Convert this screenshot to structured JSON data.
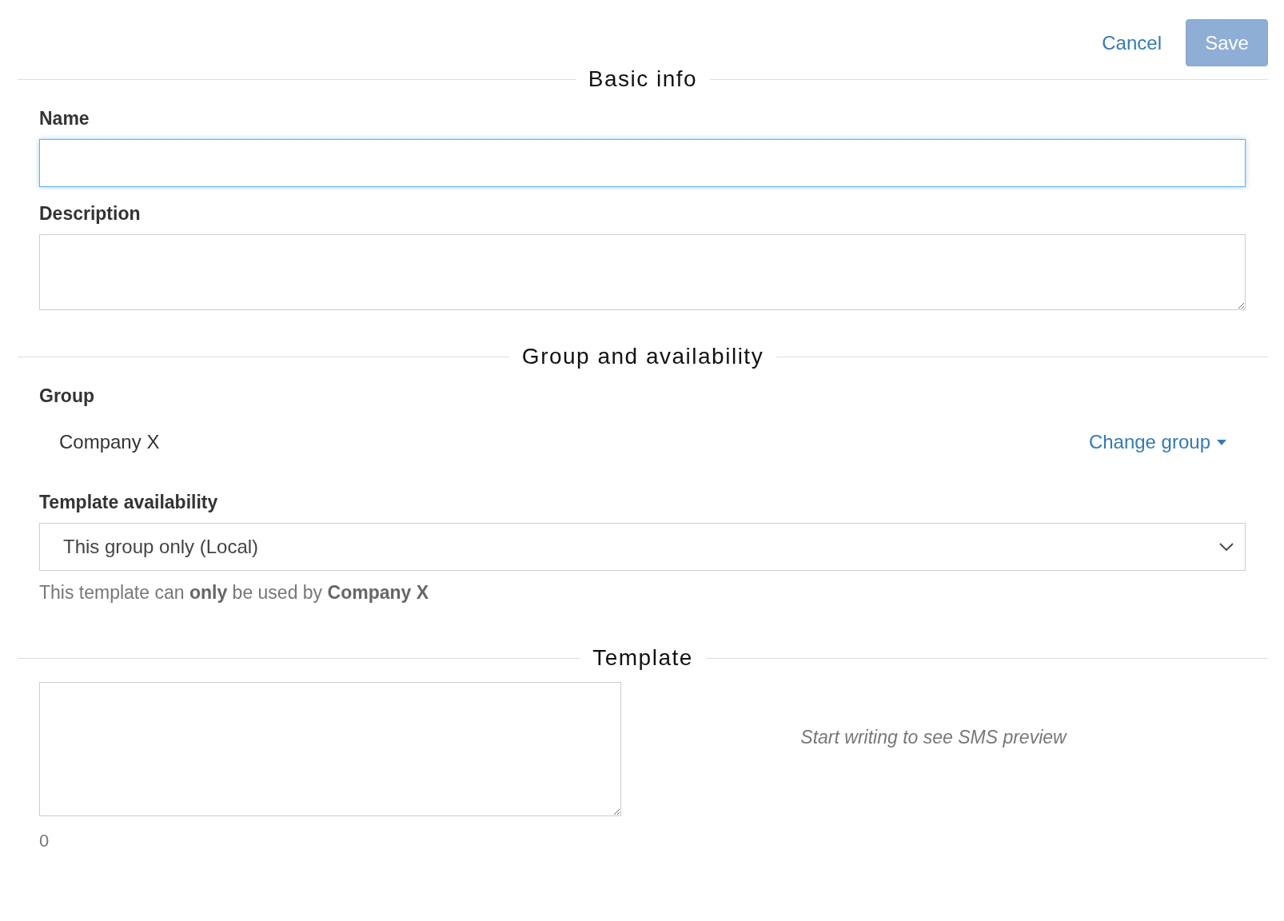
{
  "actions": {
    "cancel": "Cancel",
    "save": {
      "label": "Save",
      "disabled": true
    }
  },
  "sections": [
    {
      "heading": "Basic info",
      "fields": [
        {
          "kind": "text",
          "label": "Name",
          "focused": true
        },
        {
          "kind": "textarea",
          "label": "Description"
        }
      ]
    },
    {
      "heading": "Group and availability",
      "fields": [
        {
          "kind": "group",
          "label": "Group",
          "value": "Company X",
          "action": "Change group"
        },
        {
          "kind": "select",
          "label": "Template availability",
          "value": "This group only (Local)",
          "help": "This template can **only** be used by **Company X**"
        }
      ]
    },
    {
      "heading": "Template",
      "fields": [
        {
          "kind": "template",
          "preview_note": "Start writing to see SMS preview",
          "count": "0"
        }
      ]
    }
  ]
}
